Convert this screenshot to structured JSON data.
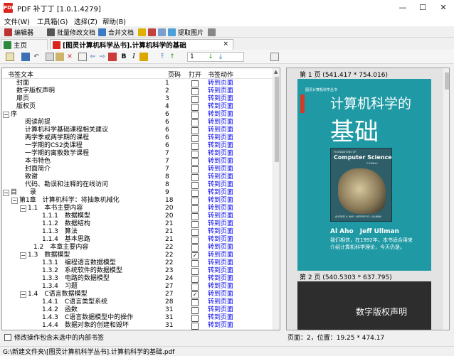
{
  "window": {
    "title": "PDF 补丁丁 [1.0.1.4279]",
    "app_icon": "PDF",
    "controls": [
      "—",
      "☐",
      "✕"
    ]
  },
  "menu": [
    "文件(W)",
    "工具箱(G)",
    "选择(Z)",
    "帮助(B)"
  ],
  "toolbar": {
    "editor": "编辑器",
    "batch_modify": "批量修改文档",
    "merge": "合并文档",
    "extract_images": "提取图片"
  },
  "tabs": {
    "home": "主页",
    "document": "[图灵计算机科学丛书].计算机科学的基础",
    "close": "×"
  },
  "page_input": "1",
  "bookmark_columns": {
    "text": "书签文本",
    "page": "页码",
    "open": "打开",
    "action": "书签动作"
  },
  "bookmarks": [
    {
      "t": "封面",
      "p": "1",
      "a": "转到页面",
      "lv": 0
    },
    {
      "t": "数字版权声明",
      "p": "2",
      "a": "转到页面",
      "lv": 0
    },
    {
      "t": "扉页",
      "p": "3",
      "a": "转到页面",
      "lv": 0
    },
    {
      "t": "版权页",
      "p": "4",
      "a": "转到页面",
      "lv": 0
    },
    {
      "t": "序",
      "p": "6",
      "a": "转到页面",
      "lv": 0,
      "exp": "−"
    },
    {
      "t": "阅读前提",
      "p": "6",
      "a": "转到页面",
      "lv": 1
    },
    {
      "t": "计算机科学基础课程相关建议",
      "p": "6",
      "a": "转到页面",
      "lv": 1
    },
    {
      "t": "两学季或两学期的课程",
      "p": "6",
      "a": "转到页面",
      "lv": 1
    },
    {
      "t": "一学期的CS2类课程",
      "p": "6",
      "a": "转到页面",
      "lv": 1
    },
    {
      "t": "一学期的离散数学课程",
      "p": "7",
      "a": "转到页面",
      "lv": 1
    },
    {
      "t": "本书特色",
      "p": "7",
      "a": "转到页面",
      "lv": 1
    },
    {
      "t": "封面简介",
      "p": "7",
      "a": "转到页面",
      "lv": 1
    },
    {
      "t": "致谢",
      "p": "8",
      "a": "转到页面",
      "lv": 1
    },
    {
      "t": "代码、勘误和注释的在线访问",
      "p": "8",
      "a": "转到页面",
      "lv": 1
    },
    {
      "t": "目　　录",
      "p": "9",
      "a": "转到页面",
      "lv": 0,
      "exp": "−"
    },
    {
      "t": "第1章　计算机科学：将抽象机械化",
      "p": "18",
      "a": "转到页面",
      "lv": 1,
      "exp": "−"
    },
    {
      "t": "1.1　本书主要内容",
      "p": "20",
      "a": "转到页面",
      "lv": 2,
      "exp": "−"
    },
    {
      "t": "1.1.1　数据模型",
      "p": "20",
      "a": "转到页面",
      "lv": 3
    },
    {
      "t": "1.1.2　数据结构",
      "p": "21",
      "a": "转到页面",
      "lv": 3
    },
    {
      "t": "1.1.3　算法",
      "p": "21",
      "a": "转到页面",
      "lv": 3
    },
    {
      "t": "1.1.4　基本思路",
      "p": "21",
      "a": "转到页面",
      "lv": 3
    },
    {
      "t": "1.2　本章主要内容",
      "p": "22",
      "a": "转到页面",
      "lv": 2
    },
    {
      "t": "1.3　数据模型",
      "p": "22",
      "a": "转到页面",
      "lv": 2,
      "exp": "−",
      "chk": true
    },
    {
      "t": "1.3.1　编程语言数据模型",
      "p": "22",
      "a": "转到页面",
      "lv": 3
    },
    {
      "t": "1.3.2　系统软件的数据模型",
      "p": "23",
      "a": "转到页面",
      "lv": 3
    },
    {
      "t": "1.3.3　电路的数据模型",
      "p": "24",
      "a": "转到页面",
      "lv": 3
    },
    {
      "t": "1.3.4　习题",
      "p": "27",
      "a": "转到页面",
      "lv": 3
    },
    {
      "t": "1.4　C语言数据模型",
      "p": "27",
      "a": "转到页面",
      "lv": 2,
      "exp": "−",
      "chk": true
    },
    {
      "t": "1.4.1　C语言类型系统",
      "p": "28",
      "a": "转到页面",
      "lv": 3
    },
    {
      "t": "1.4.2　函数",
      "p": "31",
      "a": "转到页面",
      "lv": 3
    },
    {
      "t": "1.4.3　C语言数据模型中的操作",
      "p": "31",
      "a": "转到页面",
      "lv": 3
    },
    {
      "t": "1.4.4　数据对象的创建和毁坏",
      "p": "31",
      "a": "转到页面",
      "lv": 3
    }
  ],
  "bottom_option": "修改操作包含未选中的内部书签",
  "preview": {
    "page1_header": "第 1 页 (541.417 * 754.016)",
    "page2_header": "第 2 页 (540.5303 * 637.795)",
    "cover_series": "图灵计算机科学丛书",
    "cover_title_line1": "计算机科学的",
    "cover_title_line2": "基础",
    "book_small": "FOUNDATIONS OF",
    "book_title": "Computer Science",
    "book_edition": "C Edition",
    "book_authors": "ALFRED V. AHO · JEFFREY D. ULLMAN",
    "authors": "Al Aho　Jeff Ullman",
    "blurb_line1": "我们相信，在1992年，本书适合用来",
    "blurb_line2": "介绍计算机科学理论，今天仍是。",
    "page2_text": "数字版权声明"
  },
  "page_info": "页面：2，位置：19.25 * 474.17",
  "status_path": "G:\\新建文件夹\\[图灵计算机科学丛书].计算机科学的基础.pdf",
  "colors": {
    "link": "#0000ee",
    "cover": "#1f9aa5",
    "pdf_red": "#d9251c"
  }
}
